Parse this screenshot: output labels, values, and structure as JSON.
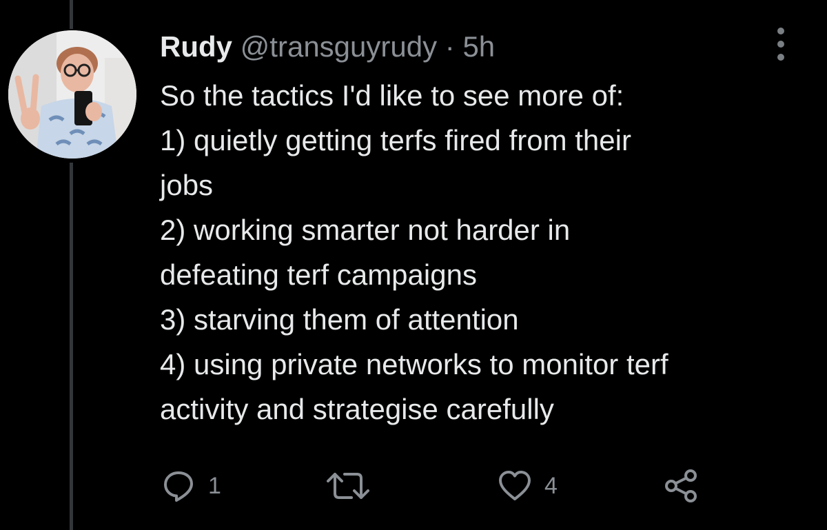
{
  "tweet": {
    "author": {
      "display_name": "Rudy",
      "handle": "@transguyrudy",
      "separator": "·",
      "time_ago": "5h"
    },
    "lines": [
      "So the tactics I'd like to see more of:",
      "1) quietly getting terfs fired from their",
      "jobs",
      "2) working smarter not harder in",
      "defeating terf campaigns",
      "3) starving them of attention",
      "4) using private networks to monitor terf",
      "activity and strategise carefully"
    ],
    "actions": {
      "reply_count": "1",
      "retweet_count": "",
      "like_count": "4"
    }
  },
  "icons": {
    "reply": "comment-bubble-icon",
    "retweet": "retweet-arrows-icon",
    "like": "heart-icon",
    "share": "share-nodes-icon",
    "more": "more-vertical-icon"
  },
  "colors": {
    "background": "#000000",
    "text_primary": "#e7e9ea",
    "text_secondary": "#8b9096",
    "thread_line": "#333639"
  }
}
